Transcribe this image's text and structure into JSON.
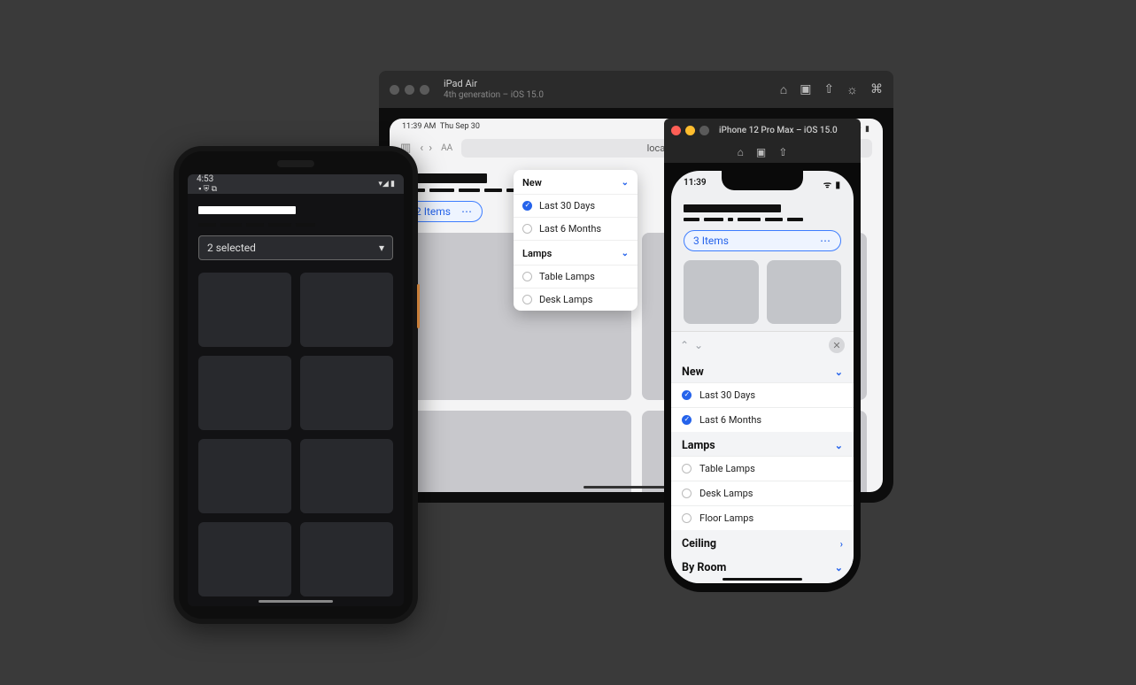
{
  "ipad_sim": {
    "title": "iPad Air",
    "subtitle": "4th generation – iOS 15.0",
    "statusbar": {
      "time": "11:39 AM",
      "date": "Thu Sep 30"
    },
    "safari_url": "localhost",
    "chip_label": "2 Items"
  },
  "dropdown": {
    "section1": {
      "title": "New",
      "item1": "Last 30 Days",
      "item2": "Last 6 Months"
    },
    "section2": {
      "title": "Lamps",
      "item1": "Table Lamps",
      "item2": "Desk Lamps"
    }
  },
  "iphone_sim": {
    "titlebar": "iPhone 12 Pro Max – iOS 15.0",
    "statusbar_time": "11:39",
    "chip_label": "3 Items"
  },
  "iphone_sheet": {
    "s1_title": "New",
    "s1_item1": "Last 30 Days",
    "s1_item2": "Last 6 Months",
    "s2_title": "Lamps",
    "s2_item1": "Table Lamps",
    "s2_item2": "Desk Lamps",
    "s2_item3": "Floor Lamps",
    "s3_title": "Ceiling",
    "s4_title": "By Room"
  },
  "android": {
    "statusbar_time": "4:53",
    "select_label": "2 selected"
  }
}
